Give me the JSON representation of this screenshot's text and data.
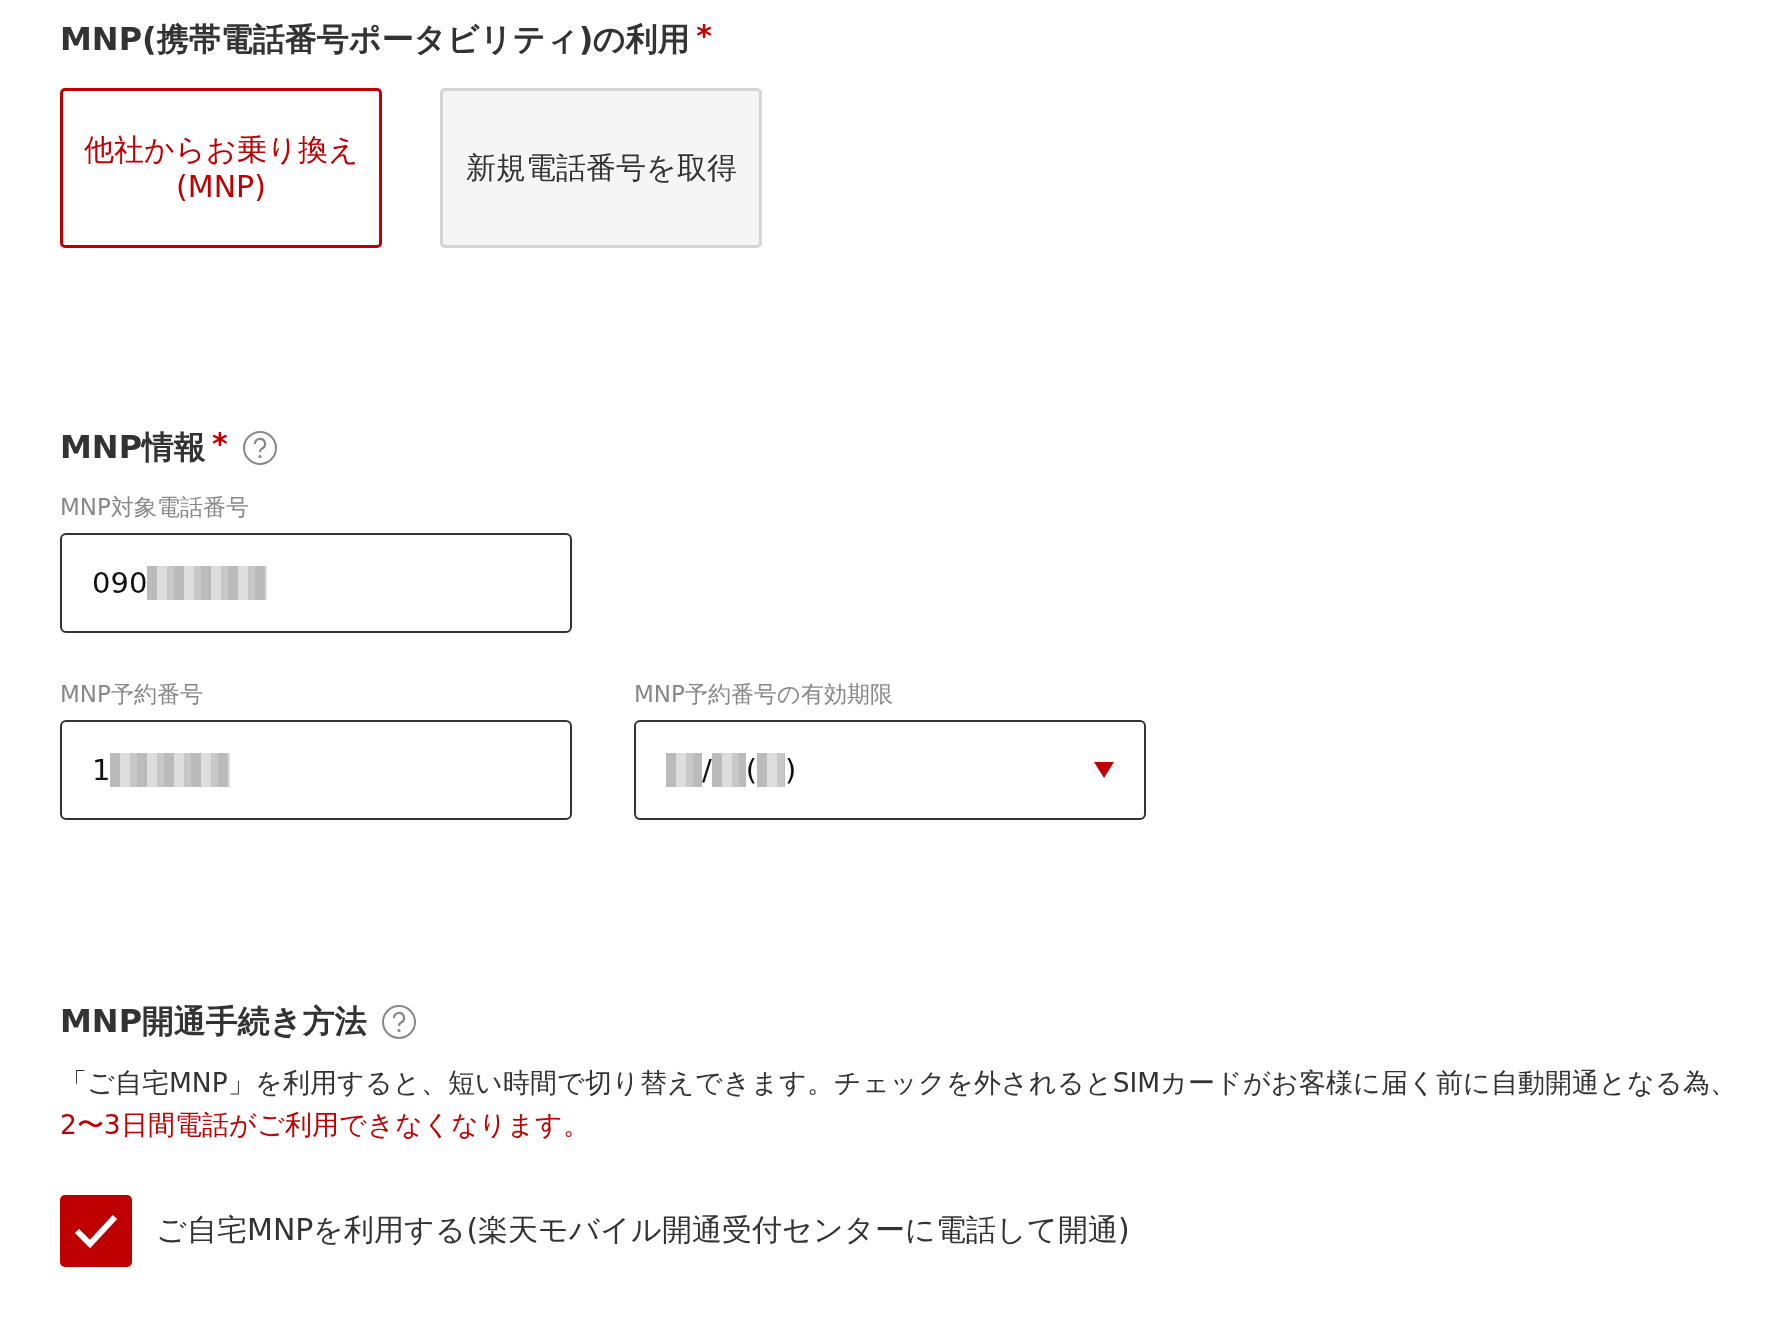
{
  "mnp_usage": {
    "title": "MNP(携帯電話番号ポータビリティ)の利用",
    "required_mark": "*",
    "options": [
      {
        "label": "他社からお乗り換え\n(MNP)",
        "selected": true
      },
      {
        "label": "新規電話番号を取得",
        "selected": false
      }
    ]
  },
  "mnp_info": {
    "title": "MNP情報",
    "required_mark": "*",
    "help": true,
    "fields": [
      {
        "kind": "text",
        "label": "MNP対象電話番号",
        "value": [
          {
            "kind": "text",
            "text": "090"
          },
          {
            "kind": "redacted"
          }
        ]
      },
      {
        "kind": "text",
        "label": "MNP予約番号",
        "value": [
          {
            "kind": "text",
            "text": "1"
          },
          {
            "kind": "redacted"
          }
        ]
      },
      {
        "kind": "select",
        "label": "MNP予約番号の有効期限",
        "value": [
          {
            "kind": "redacted"
          },
          {
            "kind": "text",
            "text": "/"
          },
          {
            "kind": "redacted"
          },
          {
            "kind": "text",
            "text": "("
          },
          {
            "kind": "redacted"
          },
          {
            "kind": "text",
            "text": ")"
          }
        ]
      }
    ]
  },
  "mnp_activation": {
    "title": "MNP開通手続き方法",
    "help": true,
    "description": "「ご自宅MNP」を利用すると、短い時間で切り替えできます。チェックを外されるとSIMカードがお客様に届く前に自動開通となる為、",
    "warning": "2〜3日間電話がご利用できなくなります。",
    "checkbox": {
      "label": "ご自宅MNPを利用する(楽天モバイル開通受付センターに電話して開通)",
      "checked": true
    }
  }
}
